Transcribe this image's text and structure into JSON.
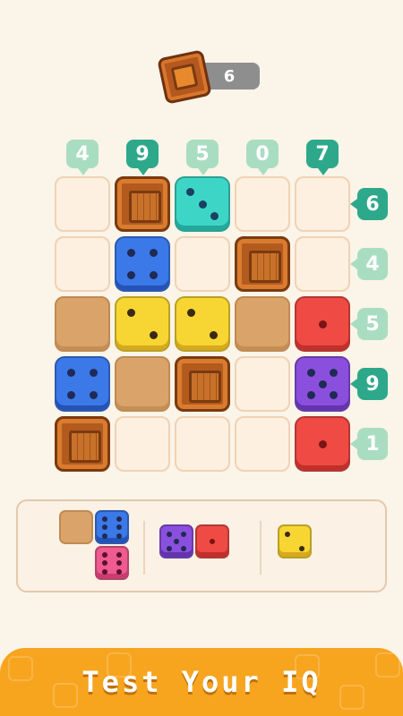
{
  "header": {
    "counter_value": "6",
    "counter_icon": "crate-icon"
  },
  "column_targets": [
    {
      "value": "4",
      "state": "pending"
    },
    {
      "value": "9",
      "state": "done"
    },
    {
      "value": "5",
      "state": "pending"
    },
    {
      "value": "0",
      "state": "pending"
    },
    {
      "value": "7",
      "state": "done"
    }
  ],
  "row_targets": [
    {
      "value": "6",
      "state": "done"
    },
    {
      "value": "4",
      "state": "pending"
    },
    {
      "value": "5",
      "state": "pending"
    },
    {
      "value": "9",
      "state": "done"
    },
    {
      "value": "1",
      "state": "pending"
    }
  ],
  "board": [
    [
      {
        "type": "empty"
      },
      {
        "type": "crate"
      },
      {
        "type": "die",
        "color": "teal",
        "pips": 3
      },
      {
        "type": "empty"
      },
      {
        "type": "empty"
      }
    ],
    [
      {
        "type": "empty"
      },
      {
        "type": "die",
        "color": "blue",
        "pips": 4
      },
      {
        "type": "empty"
      },
      {
        "type": "crate"
      },
      {
        "type": "empty"
      }
    ],
    [
      {
        "type": "plank"
      },
      {
        "type": "die",
        "color": "yellow",
        "pips": 2
      },
      {
        "type": "die",
        "color": "yellow",
        "pips": 2
      },
      {
        "type": "plank"
      },
      {
        "type": "die",
        "color": "red",
        "pips": 1
      }
    ],
    [
      {
        "type": "die",
        "color": "blue",
        "pips": 4
      },
      {
        "type": "plank"
      },
      {
        "type": "crate"
      },
      {
        "type": "empty"
      },
      {
        "type": "die",
        "color": "purple",
        "pips": 5
      }
    ],
    [
      {
        "type": "crate"
      },
      {
        "type": "empty"
      },
      {
        "type": "empty"
      },
      {
        "type": "empty"
      },
      {
        "type": "die",
        "color": "red",
        "pips": 1
      }
    ]
  ],
  "tray_pieces": [
    {
      "name": "piece-plank-blue-pink",
      "cells": [
        {
          "dx": 0,
          "dy": 0,
          "type": "plank"
        },
        {
          "dx": 1,
          "dy": 0,
          "type": "die",
          "color": "blue",
          "pips": 6
        },
        {
          "dx": 1,
          "dy": 1,
          "type": "die",
          "color": "pink",
          "pips": 6
        }
      ]
    },
    {
      "name": "piece-purple-red",
      "cells": [
        {
          "dx": 0,
          "dy": 0,
          "type": "die",
          "color": "purple",
          "pips": 5
        },
        {
          "dx": 1,
          "dy": 0,
          "type": "die",
          "color": "red",
          "pips": 1
        }
      ]
    },
    {
      "name": "piece-yellow",
      "cells": [
        {
          "dx": 0,
          "dy": 0,
          "type": "die",
          "color": "yellow",
          "pips": 2
        }
      ]
    }
  ],
  "banner": {
    "title": "Test Your IQ"
  },
  "colors": {
    "background": "#fbf4e8",
    "tag_done": "#2ea88a",
    "tag_pending": "#a9ddc2",
    "banner": "#f7a51f"
  }
}
